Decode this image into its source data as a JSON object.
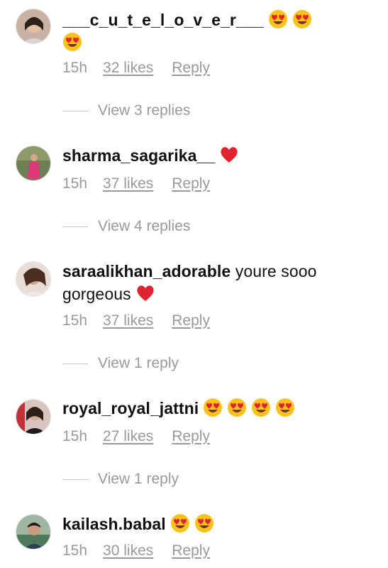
{
  "comments": [
    {
      "username": "___c_u_t_e_l_o_v_e_r___",
      "text": "",
      "emojis": [
        "heart-eyes-emoji",
        "heart-eyes-emoji",
        "heart-eyes-emoji"
      ],
      "time": "15h",
      "likes": "32 likes",
      "reply": "Reply",
      "view_replies": "View 3 replies"
    },
    {
      "username": "sharma_sagarika__",
      "text": "",
      "emojis": [
        "red-heart-emoji"
      ],
      "time": "15h",
      "likes": "37 likes",
      "reply": "Reply",
      "view_replies": "View 4 replies"
    },
    {
      "username": "saraalikhan_adorable",
      "text": "youre sooo gorgeous",
      "emojis": [
        "red-heart-emoji"
      ],
      "time": "15h",
      "likes": "37 likes",
      "reply": "Reply",
      "view_replies": "View 1 reply"
    },
    {
      "username": "royal_royal_jattni",
      "text": "",
      "emojis": [
        "heart-eyes-emoji",
        "heart-eyes-emoji",
        "heart-eyes-emoji",
        "heart-eyes-emoji"
      ],
      "time": "15h",
      "likes": "27 likes",
      "reply": "Reply",
      "view_replies": "View 1 reply"
    },
    {
      "username": "kailash.babal",
      "text": "",
      "emojis": [
        "heart-eyes-emoji",
        "heart-eyes-emoji"
      ],
      "time": "15h",
      "likes": "30 likes",
      "reply": "Reply"
    }
  ],
  "colors": {
    "meta_text": "#9a9a9a",
    "emoji_face": "#fcc21b",
    "heart": "#e0242f"
  }
}
